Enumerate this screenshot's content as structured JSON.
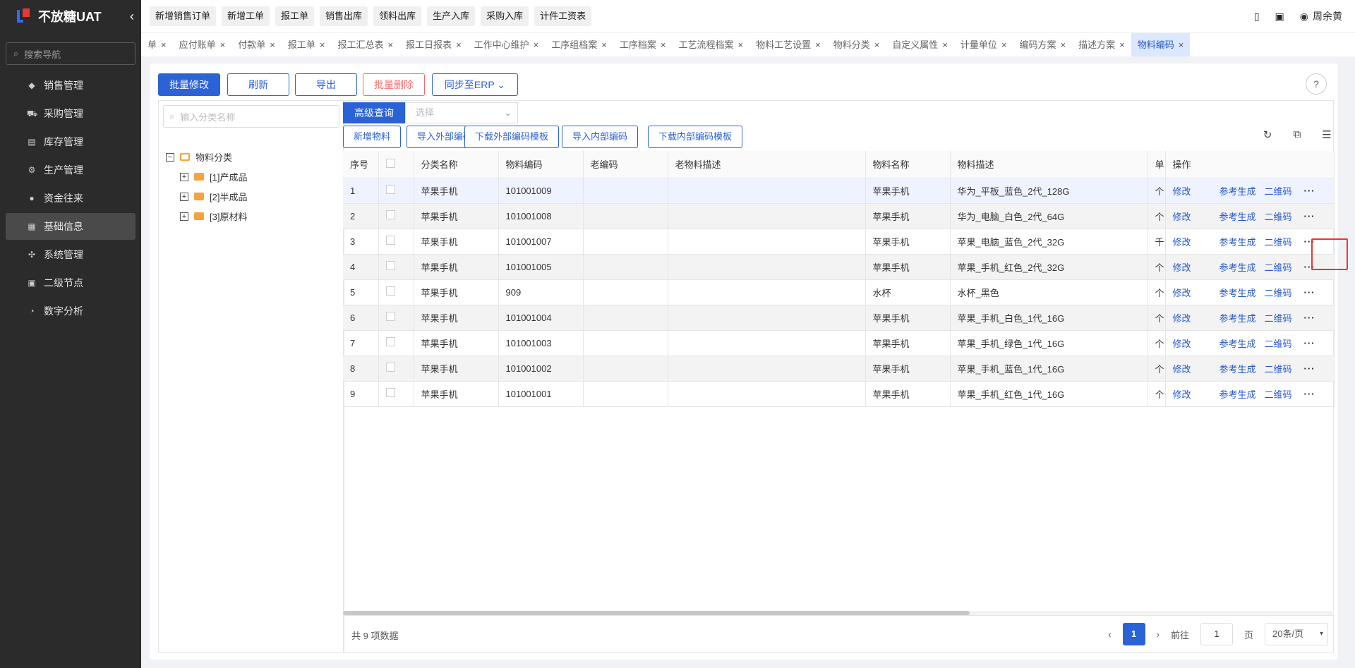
{
  "app": {
    "title": "不放糖UAT",
    "search_placeholder": "搜索导航"
  },
  "sidebar": {
    "items": [
      {
        "label": "销售管理",
        "icon": "tag-icon"
      },
      {
        "label": "采购管理",
        "icon": "cart-icon"
      },
      {
        "label": "库存管理",
        "icon": "inventory-icon"
      },
      {
        "label": "生产管理",
        "icon": "production-icon"
      },
      {
        "label": "资金往来",
        "icon": "money-icon"
      },
      {
        "label": "基础信息",
        "icon": "basic-info-icon",
        "active": true
      },
      {
        "label": "系统管理",
        "icon": "system-icon"
      },
      {
        "label": "二级节点",
        "icon": "node-icon"
      },
      {
        "label": "数字分析",
        "icon": "pie-icon"
      }
    ]
  },
  "topbar": {
    "quick": [
      "新增销售订单",
      "新增工单",
      "报工单",
      "销售出库",
      "领料出库",
      "生产入库",
      "采购入库",
      "计件工资表"
    ],
    "user": "周余黄"
  },
  "tabs": [
    "单",
    "应付账单",
    "付款单",
    "报工单",
    "报工汇总表",
    "报工日报表",
    "工作中心维护",
    "工序组档案",
    "工序档案",
    "工艺流程档案",
    "物料工艺设置",
    "物料分类",
    "自定义属性",
    "计量单位",
    "编码方案",
    "描述方案",
    "物料编码"
  ],
  "actions": {
    "batch_edit": "批量修改",
    "refresh": "刷新",
    "export": "导出",
    "batch_delete": "批量删除",
    "sync": "同步至ERP"
  },
  "tree": {
    "placeholder": "输入分类名称",
    "root": "物料分类",
    "children": [
      "[1]产成品",
      "[2]半成品",
      "[3]原材料"
    ]
  },
  "query": {
    "advanced": "高级查询",
    "select_placeholder": "选择"
  },
  "buttons2": [
    "新增物料",
    "导入外部编码",
    "下载外部编码模板",
    "导入内部编码",
    "下载内部编码模板"
  ],
  "table": {
    "headers": [
      "序号",
      "",
      "分类名称",
      "物料编码",
      "老编码",
      "老物料描述",
      "物料名称",
      "物料描述",
      "单",
      "操作"
    ],
    "rows": [
      {
        "no": "1",
        "cat": "苹果手机",
        "code": "101001009",
        "name": "苹果手机",
        "desc": "华为_平板_蓝色_2代_128G",
        "unit": "个"
      },
      {
        "no": "2",
        "cat": "苹果手机",
        "code": "101001008",
        "name": "苹果手机",
        "desc": "华为_电脑_白色_2代_64G",
        "unit": "个"
      },
      {
        "no": "3",
        "cat": "苹果手机",
        "code": "101001007",
        "name": "苹果手机",
        "desc": "苹果_电脑_蓝色_2代_32G",
        "unit": "千"
      },
      {
        "no": "4",
        "cat": "苹果手机",
        "code": "101001005",
        "name": "苹果手机",
        "desc": "苹果_手机_红色_2代_32G",
        "unit": "个"
      },
      {
        "no": "5",
        "cat": "苹果手机",
        "code": "909",
        "name": "水杯",
        "desc": "水杯_黑色",
        "unit": "个"
      },
      {
        "no": "6",
        "cat": "苹果手机",
        "code": "101001004",
        "name": "苹果手机",
        "desc": "苹果_手机_白色_1代_16G",
        "unit": "个"
      },
      {
        "no": "7",
        "cat": "苹果手机",
        "code": "101001003",
        "name": "苹果手机",
        "desc": "苹果_手机_绿色_1代_16G",
        "unit": "个"
      },
      {
        "no": "8",
        "cat": "苹果手机",
        "code": "101001002",
        "name": "苹果手机",
        "desc": "苹果_手机_蓝色_1代_16G",
        "unit": "个"
      },
      {
        "no": "9",
        "cat": "苹果手机",
        "code": "101001001",
        "name": "苹果手机",
        "desc": "苹果_手机_红色_1代_16G",
        "unit": "个"
      }
    ],
    "ops": [
      "修改",
      "参考生成",
      "二维码"
    ]
  },
  "footer": {
    "total": "共 9 项数据",
    "page": "1",
    "goto_label": "前往",
    "goto_value": "1",
    "page_suffix": "页",
    "page_size": "20条/页"
  },
  "colors": {
    "primary": "#2b62d6",
    "danger": "#f56c6c",
    "sidebar": "#2b2b2b",
    "highlight": "#e53935"
  }
}
